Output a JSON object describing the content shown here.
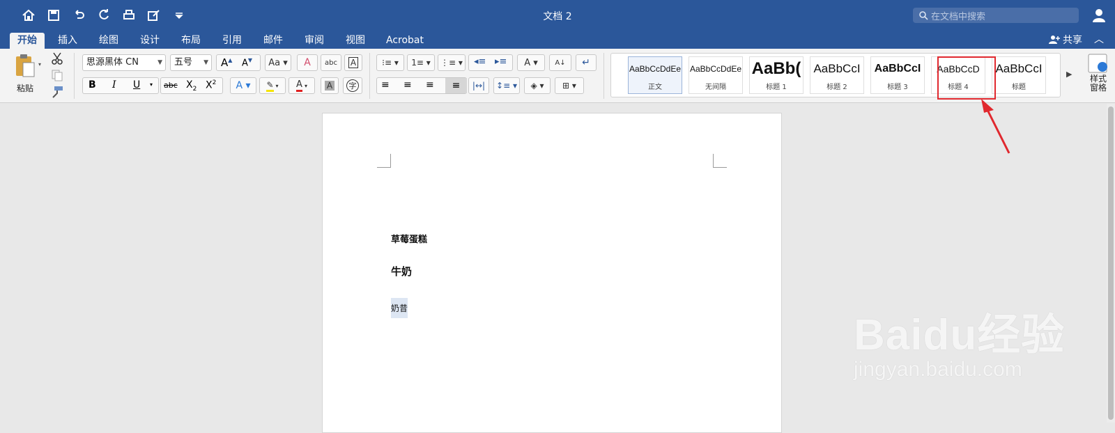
{
  "window": {
    "title": "文档 2"
  },
  "search": {
    "placeholder": "在文档中搜索"
  },
  "tabs": [
    "开始",
    "插入",
    "绘图",
    "设计",
    "布局",
    "引用",
    "邮件",
    "审阅",
    "视图",
    "Acrobat"
  ],
  "share_label": "共享",
  "clipboard": {
    "paste_label": "粘贴"
  },
  "font": {
    "name": "思源黑体 CN",
    "size": "五号"
  },
  "styles": [
    {
      "sample": "AaBbCcDdEe",
      "name": "正文"
    },
    {
      "sample": "AaBbCcDdEe",
      "name": "无间隔"
    },
    {
      "sample": "AaBb(",
      "name": "标题 1"
    },
    {
      "sample": "AaBbCcI",
      "name": "标题 2"
    },
    {
      "sample": "AaBbCcI",
      "name": "标题 3"
    },
    {
      "sample": "AaBbCcD",
      "name": "标题 4"
    },
    {
      "sample": "AaBbCcI",
      "name": "标题"
    }
  ],
  "style_pane_label": "样式窗格",
  "document": {
    "paragraphs": [
      {
        "style": "标题 4",
        "text": "草莓蛋糕"
      },
      {
        "style": "标题 3",
        "text": "牛奶"
      },
      {
        "style": "正文",
        "text": "奶昔"
      }
    ]
  },
  "watermark": {
    "brand": "Baidu经验",
    "url": "jingyan.baidu.com"
  },
  "colors": {
    "titlebar": "#2b579a",
    "highlight_box": "#e0282e",
    "font_color_bar": "#e02020",
    "highlight_color_bar": "#f5e400"
  }
}
